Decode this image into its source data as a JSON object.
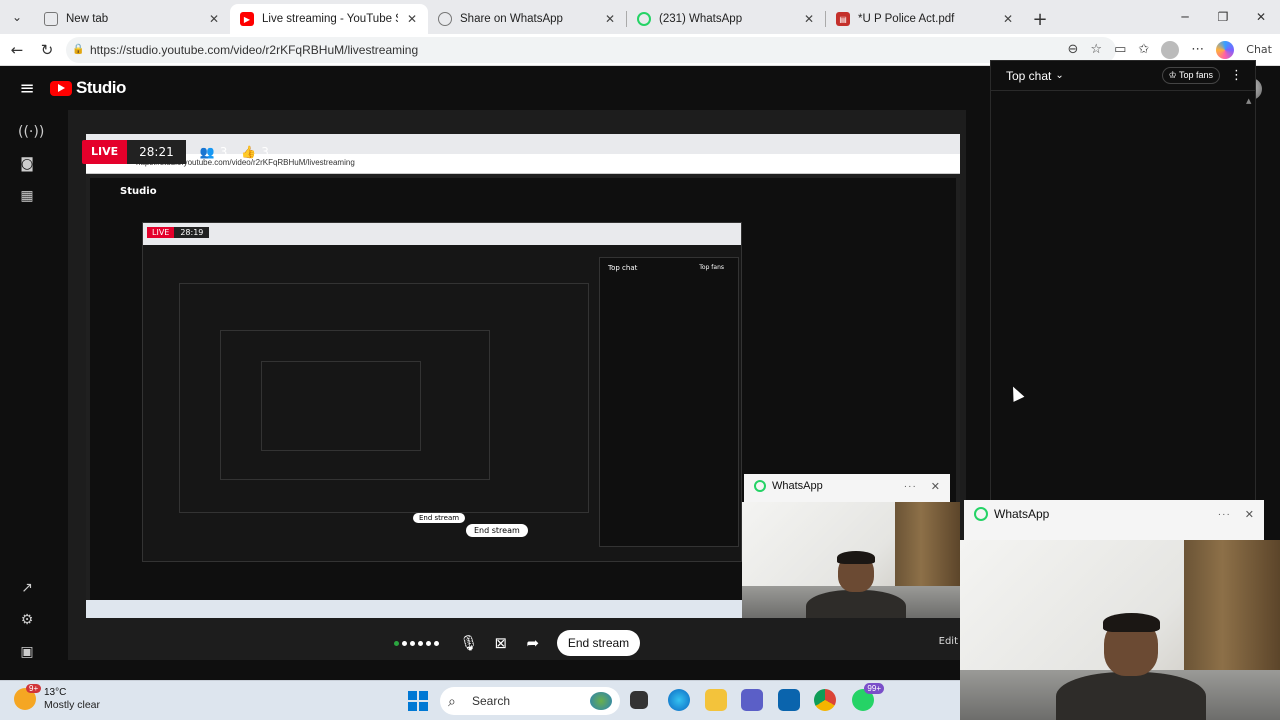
{
  "browser": {
    "tabs": [
      {
        "title": "New tab",
        "active": false,
        "favicon": "page-icon",
        "color": "#7a7a7a"
      },
      {
        "title": "Live streaming - YouTube Stu",
        "active": true,
        "favicon": "youtube-icon",
        "color": "#ff0000"
      },
      {
        "title": "Share on WhatsApp",
        "active": false,
        "favicon": "globe-icon",
        "color": "#7a7a7a"
      },
      {
        "title": "(231) WhatsApp",
        "active": false,
        "favicon": "whatsapp-icon",
        "color": "#25d366"
      },
      {
        "title": "*U P Police Act.pdf",
        "active": false,
        "favicon": "pdf-icon",
        "color": "#c4302b"
      }
    ],
    "url": "https://studio.youtube.com/video/r2rKFqRBHuM/livestreaming",
    "copilot_label": "Chat"
  },
  "studio": {
    "brand": "Studio",
    "live": {
      "badge": "LIVE",
      "elapsed": "28:21",
      "viewers": "3",
      "likes": "3"
    },
    "controls": {
      "end_label": "End stream",
      "edit_label": "Edit"
    },
    "nested": {
      "elapsed": "28:19",
      "end_label": "End stream",
      "top_chat": "Top chat",
      "top_fans": "Top fans",
      "live": "LIVE",
      "brand": "Studio"
    }
  },
  "chat": {
    "title": "Top chat",
    "top_fans": "Top fans"
  },
  "whatsapp": {
    "title": "WhatsApp"
  },
  "taskbar": {
    "temperature": "13°C",
    "condition": "Mostly clear",
    "weather_badge": "9+",
    "search_placeholder": "Search",
    "whatsapp_badge": "99+"
  },
  "colors": {
    "live_red": "#e4002b",
    "yt_red": "#ff0000",
    "whatsapp_green": "#25d366",
    "win_blue": "#0078d4"
  }
}
